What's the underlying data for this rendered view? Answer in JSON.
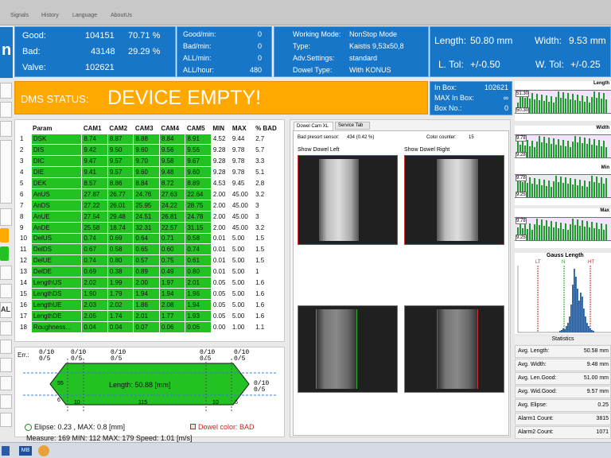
{
  "menu": [
    "Signals",
    "History",
    "Language",
    "AboutUs"
  ],
  "top": {
    "good_label": "Good:",
    "good_value": "104151",
    "good_pct": "70.71 %",
    "bad_label": "Bad:",
    "bad_value": "43148",
    "bad_pct": "29.29 %",
    "valve_label": "Valve:",
    "valve_value": "102621",
    "rates": [
      {
        "label": "Good/min:",
        "value": "0"
      },
      {
        "label": "Bad/min:",
        "value": "0"
      },
      {
        "label": "ALL/min:",
        "value": "0"
      },
      {
        "label": "ALL/hour:",
        "value": "480"
      }
    ],
    "mode": [
      {
        "label": "Working Mode:",
        "value": "NonStop Mode"
      },
      {
        "label": "Type:",
        "value": "Kaistis 9,53x50,8"
      },
      {
        "label": "Adv.Settings:",
        "value": "standard"
      },
      {
        "label": "Dowel Type:",
        "value": "With KONUS"
      }
    ],
    "length_label": "Length:",
    "length_value": "50.80 mm",
    "width_label": "Width:",
    "width_value": "9.53 mm",
    "ltol_label": "L. Tol:",
    "ltol_value": "+/-0.50",
    "wtol_label": "W. Tol:",
    "wtol_value": "+/-0.25"
  },
  "status": {
    "label": "DMS STATUS:",
    "text": "DEVICE EMPTY!"
  },
  "box": {
    "inbox_label": "In Box:",
    "inbox_value": "102621",
    "max_label": "MAX In Box:",
    "max_value": "∞",
    "boxno_label": "Box No.:",
    "boxno_value": "0"
  },
  "params_headers": [
    "Param",
    "CAM1",
    "CAM2",
    "CAM3",
    "CAM4",
    "CAM5",
    "MIN",
    "MAX",
    "% BAD"
  ],
  "params": [
    [
      "1",
      "DSK",
      "8.74",
      "8.87",
      "8.88",
      "8.84",
      "8.91",
      "4.52",
      "9.44",
      "2.7"
    ],
    [
      "2",
      "DIS",
      "9.42",
      "9.50",
      "9.60",
      "9.56",
      "9.56",
      "9.28",
      "9.78",
      "5.7"
    ],
    [
      "3",
      "DIC",
      "9.47",
      "9.57",
      "9.70",
      "9.58",
      "9.67",
      "9.28",
      "9.78",
      "3.3"
    ],
    [
      "4",
      "DIE",
      "9.41",
      "9.57",
      "9.60",
      "9.48",
      "9.60",
      "9.28",
      "9.78",
      "5.1"
    ],
    [
      "5",
      "DEK",
      "8.57",
      "8.86",
      "8.84",
      "8.72",
      "8.89",
      "4.53",
      "9.45",
      "2.8"
    ],
    [
      "6",
      "AnUS",
      "27.87",
      "26.77",
      "24.76",
      "27.63",
      "22.64",
      "2.00",
      "45.00",
      "3.2"
    ],
    [
      "7",
      "AnDS",
      "27.22",
      "26.01",
      "25.95",
      "24.22",
      "28.75",
      "2.00",
      "45.00",
      "3"
    ],
    [
      "8",
      "AnUE",
      "27.54",
      "29.48",
      "24.51",
      "26.81",
      "24.78",
      "2.00",
      "45.00",
      "3"
    ],
    [
      "9",
      "AnDE",
      "25.58",
      "18.74",
      "32.31",
      "22.57",
      "31.15",
      "2.00",
      "45.00",
      "3.2"
    ],
    [
      "10",
      "DelUS",
      "0.74",
      "0.69",
      "0.64",
      "0.71",
      "0.58",
      "0.01",
      "5.00",
      "1.5"
    ],
    [
      "11",
      "DelDS",
      "0.67",
      "0.58",
      "0.65",
      "0.60",
      "0.74",
      "0.01",
      "5.00",
      "1.5"
    ],
    [
      "12",
      "DelUE",
      "0.74",
      "0.80",
      "0.57",
      "0.75",
      "0.61",
      "0.01",
      "5.00",
      "1.5"
    ],
    [
      "13",
      "DelDE",
      "0.69",
      "0.38",
      "0.89",
      "0.49",
      "0.80",
      "0.01",
      "5.00",
      "1"
    ],
    [
      "14",
      "LengthUS",
      "2.02",
      "1.99",
      "2.00",
      "1.97",
      "2.01",
      "0.05",
      "5.00",
      "1.6"
    ],
    [
      "15",
      "LengthDS",
      "1.90",
      "1.79",
      "1.94",
      "1.94",
      "1.96",
      "0.05",
      "5.00",
      "1.6"
    ],
    [
      "16",
      "LengthUE",
      "2.03",
      "2.02",
      "1.86",
      "2.08",
      "1.94",
      "0.05",
      "5.00",
      "1.6"
    ],
    [
      "17",
      "LengthDE",
      "2.05",
      "1.74",
      "2.01",
      "1.77",
      "1.93",
      "0.05",
      "5.00",
      "1.6"
    ],
    [
      "18",
      "Roughness...",
      "0.04",
      "0.04",
      "0.07",
      "0.06",
      "0.06",
      "0.00",
      "1.00",
      "1.1"
    ]
  ],
  "err_label": "Err.:",
  "dowel": {
    "frac_a": "0/10",
    "frac_b": "0/5",
    "length_text": "Length: 50.88 [mm]",
    "dims": {
      "left_top": "55",
      "left_bottom": "6",
      "d10a": "10",
      "d115": "115",
      "d10b": "10",
      "d6": "6"
    },
    "ellipse_text": "Elipse: 0.23 , MAX: 0.8 [mm]",
    "color_text": "Dowel color: BAD",
    "measure_text": "Measure: 169 MIN: 112 MAX: 179   Speed: 1.01 [m/s]"
  },
  "camera": {
    "tabs": [
      "Dowel Cam XL",
      "Service Tab"
    ],
    "bad_presort_label": "Bad presort sensor:",
    "bad_presort_value": "434 (0.42 %)",
    "color_counter_label": "Color counter:",
    "color_counter_value": "15",
    "show_left": "Show Dowel Left",
    "show_right": "Show Dowel Right"
  },
  "minicharts": [
    {
      "title": "Length",
      "top": "51.30",
      "bottom": "50.30"
    },
    {
      "title": "Width",
      "top": "9.78",
      "bottom": "9.28"
    },
    {
      "title": "Min",
      "top": "9.78",
      "bottom": "9.25"
    },
    {
      "title": "Max",
      "top": "9.78",
      "bottom": "9.25"
    }
  ],
  "gauss": {
    "title": "Gauss Length",
    "lt": "LT",
    "n": "N",
    "ht": "HT"
  },
  "stats": {
    "title": "Statistics",
    "rows": [
      {
        "label": "Avg. Length:",
        "value": "50.58 mm"
      },
      {
        "label": "Avg. Width:",
        "value": "9.48 mm"
      },
      {
        "label": "Avg. Len.Good:",
        "value": "51.00 mm"
      },
      {
        "label": "Avg. Wid.Good:",
        "value": "9.57 mm"
      },
      {
        "label": "Avg. Elipse:",
        "value": "0.25"
      },
      {
        "label": "Alarm1 Count:",
        "value": "3815"
      },
      {
        "label": "Alarm2 Count:",
        "value": "1071"
      }
    ]
  },
  "taskbar": {
    "mb_label": "MB"
  },
  "colors": {
    "blue": "#1776c7",
    "orange": "#ffa800",
    "green": "#22c222",
    "red": "#cc2222"
  }
}
